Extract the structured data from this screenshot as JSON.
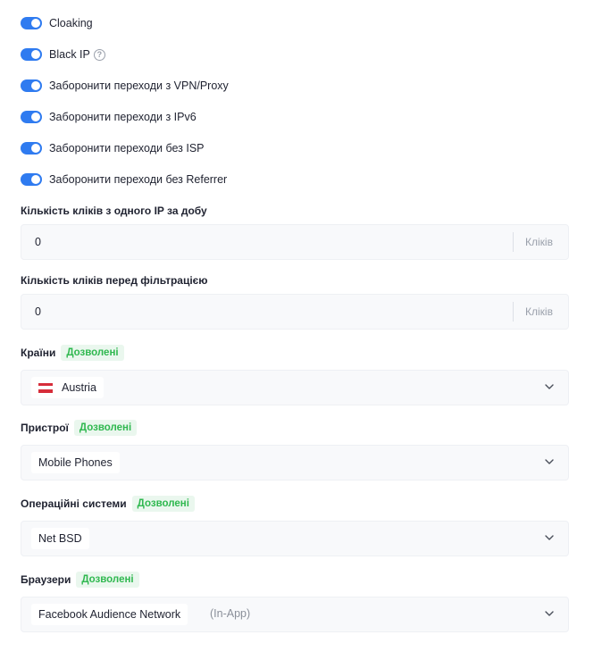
{
  "toggles": [
    {
      "label": "Cloaking",
      "on": true
    },
    {
      "label": "Black IP",
      "on": true,
      "help": "?"
    },
    {
      "label": "Заборонити переходи з VPN/Proxy",
      "on": true
    },
    {
      "label": "Заборонити переходи з IPv6",
      "on": true
    },
    {
      "label": "Заборонити переходи без ISP",
      "on": true
    },
    {
      "label": "Заборонити переходи без Referrer",
      "on": true
    }
  ],
  "clicks_per_ip": {
    "label": "Кількість кліків з одного IP за добу",
    "value": "0",
    "unit": "Кліків"
  },
  "clicks_before_filter": {
    "label": "Кількість кліків перед фільтрацією",
    "value": "0",
    "unit": "Кліків"
  },
  "countries": {
    "label": "Країни",
    "badge": "Дозволені",
    "selected": "Austria"
  },
  "devices": {
    "label": "Пристрої",
    "badge": "Дозволені",
    "selected": "Mobile Phones"
  },
  "os": {
    "label": "Операційні системи",
    "badge": "Дозволені",
    "selected": "Net BSD"
  },
  "browsers": {
    "label": "Браузери",
    "badge": "Дозволені",
    "selected": "Facebook Audience Network",
    "selected_extra": "(In-App)"
  },
  "colors": {
    "accent": "#2f7bf0",
    "badge_text": "#2fb84f",
    "badge_bg": "#eaf7ee",
    "field_bg": "#f8f9fb"
  },
  "icons": {
    "help": "question-circle-icon",
    "chevron": "chevron-down-icon",
    "flag": "austria-flag-icon"
  }
}
